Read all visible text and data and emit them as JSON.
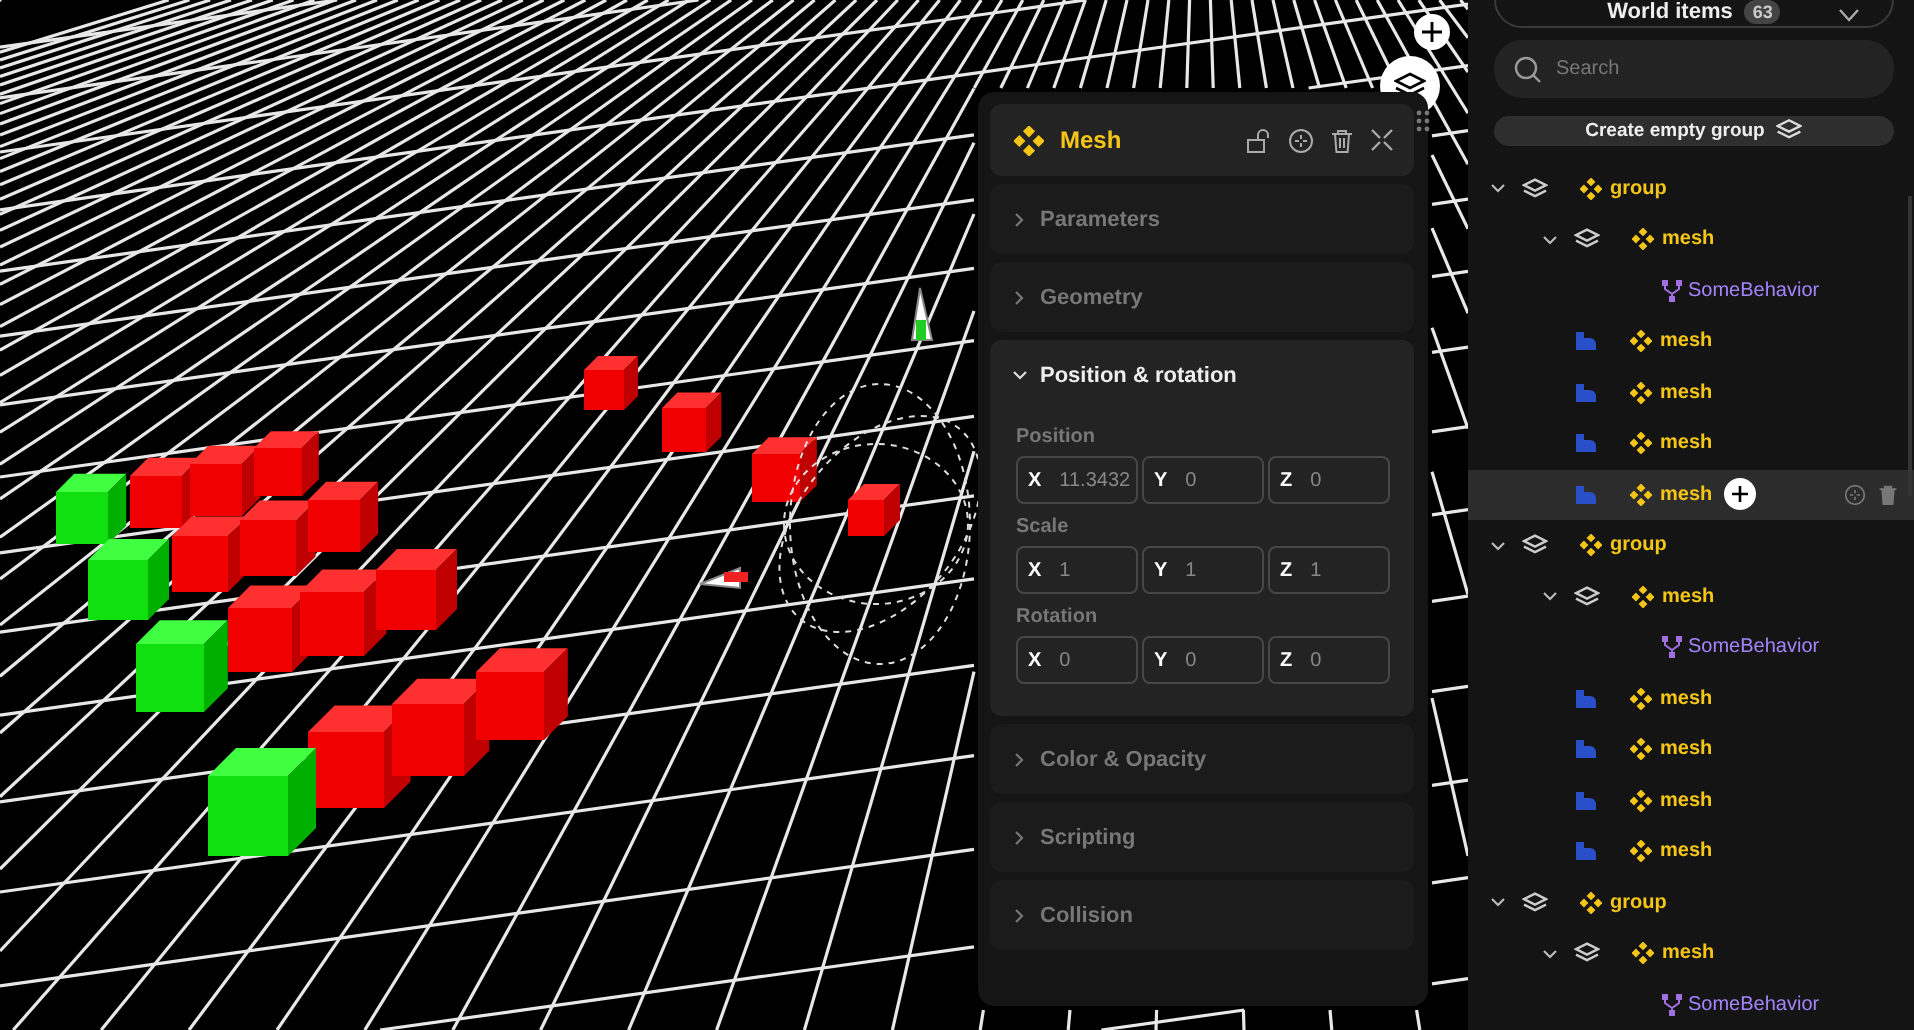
{
  "inspector": {
    "title": "Mesh",
    "sections": [
      {
        "title": "Parameters",
        "expanded": false
      },
      {
        "title": "Geometry",
        "expanded": false
      },
      {
        "title": "Position & rotation",
        "expanded": true,
        "groups": [
          {
            "label": "Position",
            "fields": [
              {
                "axis": "X",
                "value": "11.3432"
              },
              {
                "axis": "Y",
                "value": "0"
              },
              {
                "axis": "Z",
                "value": "0"
              }
            ]
          },
          {
            "label": "Scale",
            "fields": [
              {
                "axis": "X",
                "value": "1"
              },
              {
                "axis": "Y",
                "value": "1"
              },
              {
                "axis": "Z",
                "value": "1"
              }
            ]
          },
          {
            "label": "Rotation",
            "fields": [
              {
                "axis": "X",
                "value": "0"
              },
              {
                "axis": "Y",
                "value": "0"
              },
              {
                "axis": "Z",
                "value": "0"
              }
            ]
          }
        ]
      },
      {
        "title": "Color & Opacity",
        "expanded": false
      },
      {
        "title": "Scripting",
        "expanded": false
      },
      {
        "title": "Collision",
        "expanded": false
      }
    ]
  },
  "sidebar": {
    "title": "World items",
    "count": "63",
    "search": {
      "placeholder": "Search"
    },
    "create_button": "Create empty group",
    "tree": [
      {
        "kind": "group",
        "label": "group",
        "expanded": true,
        "selected": false,
        "children": [
          {
            "kind": "mesh",
            "label": "mesh",
            "expanded": true,
            "selected": false,
            "children": [
              {
                "kind": "behavior",
                "label": "SomeBehavior",
                "selected": false
              }
            ]
          },
          {
            "kind": "mesh",
            "label": "mesh",
            "selected": false
          },
          {
            "kind": "mesh",
            "label": "mesh",
            "selected": false
          },
          {
            "kind": "mesh",
            "label": "mesh",
            "selected": false
          },
          {
            "kind": "mesh",
            "label": "mesh",
            "selected": true
          }
        ]
      },
      {
        "kind": "group",
        "label": "group",
        "expanded": true,
        "selected": false,
        "children": [
          {
            "kind": "mesh",
            "label": "mesh",
            "expanded": true,
            "selected": false,
            "children": [
              {
                "kind": "behavior",
                "label": "SomeBehavior",
                "selected": false
              }
            ]
          },
          {
            "kind": "mesh",
            "label": "mesh",
            "selected": false
          },
          {
            "kind": "mesh",
            "label": "mesh",
            "selected": false
          },
          {
            "kind": "mesh",
            "label": "mesh",
            "selected": false
          },
          {
            "kind": "mesh",
            "label": "mesh",
            "selected": false
          }
        ]
      },
      {
        "kind": "group",
        "label": "group",
        "expanded": true,
        "selected": false,
        "children": [
          {
            "kind": "mesh",
            "label": "mesh",
            "expanded": true,
            "selected": false,
            "children": [
              {
                "kind": "behavior",
                "label": "SomeBehavior",
                "selected": false
              }
            ]
          }
        ]
      }
    ]
  }
}
